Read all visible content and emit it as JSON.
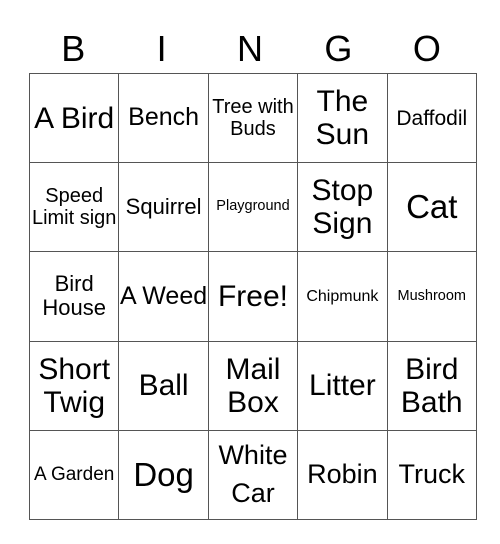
{
  "header": {
    "letters": [
      "B",
      "I",
      "N",
      "G",
      "O"
    ]
  },
  "board": [
    [
      "A Bird",
      "Bench",
      "Tree with Buds",
      "The Sun",
      "Daffodil"
    ],
    [
      "Speed Limit sign",
      "Squirrel",
      "Playground",
      "Stop Sign",
      "Cat"
    ],
    [
      "Bird House",
      "A Weed",
      "Free!",
      "Chipmunk",
      "Mushroom"
    ],
    [
      "Short Twig",
      "Ball",
      "Mail Box",
      "Litter",
      "Bird Bath"
    ],
    [
      "A Garden",
      "Dog",
      "White Car",
      "Robin",
      "Truck"
    ]
  ]
}
